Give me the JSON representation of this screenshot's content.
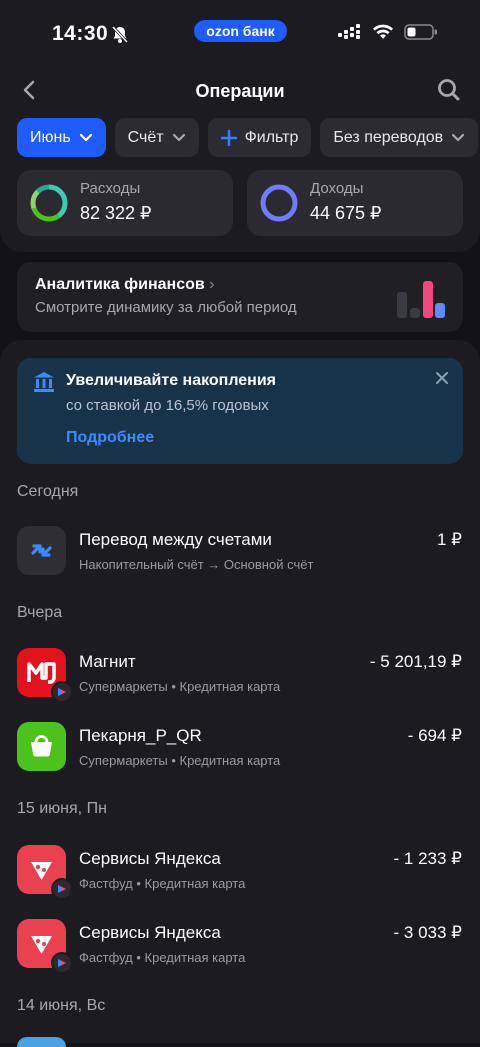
{
  "status": {
    "time": "14:30",
    "carrier_pill": "ozon банк"
  },
  "header": {
    "title": "Операции"
  },
  "filters": [
    {
      "label": "Июнь",
      "active": true
    },
    {
      "label": "Счёт",
      "active": false
    },
    {
      "label": "Фильтр",
      "active": false
    },
    {
      "label": "Без переводов",
      "active": false
    }
  ],
  "summary": {
    "expenses": {
      "label": "Расходы",
      "value": "82 322 ₽"
    },
    "income": {
      "label": "Доходы",
      "value": "44 675 ₽"
    }
  },
  "analytics": {
    "title": "Аналитика финансов",
    "subtitle": "Смотрите динамику за любой период"
  },
  "promo": {
    "title": "Увеличивайте накопления",
    "subtitle": "со ставкой до 16,5% годовых",
    "link": "Подробнее"
  },
  "sections": {
    "today": "Сегодня",
    "yesterday": "Вчера",
    "jun15": "15 июня, Пн",
    "jun14": "14 июня, Вс"
  },
  "operations": [
    {
      "name": "Перевод между счетами",
      "category": "Накопительный счёт → Основной счёт",
      "amount": "1 ₽",
      "icon": "transfer-arrows-icon"
    },
    {
      "name": "Магнит",
      "category": "Супермаркеты • Кредитная карта",
      "amount": "- 5 201,19 ₽",
      "icon": "magnit-logo-icon"
    },
    {
      "name": "Пекарня_P_QR",
      "category": "Супермаркеты • Кредитная карта",
      "amount": "- 694 ₽",
      "icon": "shopping-bag-icon"
    },
    {
      "name": "Сервисы Яндекса",
      "category": "Фастфуд • Кредитная карта",
      "amount": "- 1 233 ₽",
      "icon": "pizza-slice-icon"
    },
    {
      "name": "Сервисы Яндекса",
      "category": "Фастфуд • Кредитная карта",
      "amount": "- 3 033 ₽",
      "icon": "pizza-slice-icon"
    }
  ],
  "colors": {
    "accent": "#1f5cff",
    "link": "#3a8bff",
    "magnit": "#e3111b",
    "bakery": "#4cc21d",
    "yandex": "#e9414f"
  }
}
